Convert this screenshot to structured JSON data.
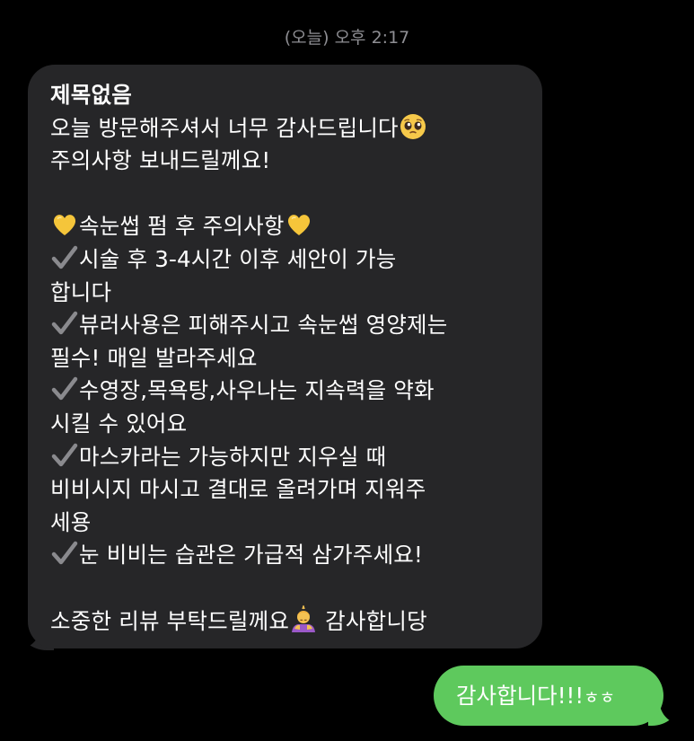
{
  "conversation": {
    "timestamp": "(오늘) 오후 2:17"
  },
  "incoming_message": {
    "title": "제목없음",
    "line_1": "오늘 방문해주셔서 너무 감사드립니다",
    "line_2": "주의사항 보내드릴께요!",
    "section_heading": "속눈썹 펌 후 주의사항",
    "item_1_a": "시술 후 3-4시간 이후 세안이 가능",
    "item_1_b": "합니다",
    "item_2_a": "뷰러사용은 피해주시고 속눈썹 영양제는",
    "item_2_b": "필수! 매일 발라주세요",
    "item_3_a": "수영장,목욕탕,사우나는 지속력을 약화",
    "item_3_b": "시킬 수 있어요",
    "item_4_a": "마스카라는 가능하지만 지우실 때",
    "item_4_b": "비비시지 마시고 결대로 올려가며 지워주",
    "item_4_c": "세용",
    "item_5": "눈 비비는 습관은 가급적 삼가주세요!",
    "closing_a": "소중한 리뷰 부탁드릴께요",
    "closing_b": "감사합니당",
    "emoji_names": [
      "pleading-face-emoji",
      "yellow-heart-emoji",
      "check-mark-emoji",
      "person-bowing-emoji"
    ]
  },
  "outgoing_message": {
    "text_main": "감사합니다!!!",
    "text_small": "ㅎㅎ"
  },
  "colors": {
    "background": "#000000",
    "incoming_bubble": "#262628",
    "outgoing_bubble": "#5ec95d",
    "timestamp": "#8e8e93",
    "text": "#ffffff"
  }
}
